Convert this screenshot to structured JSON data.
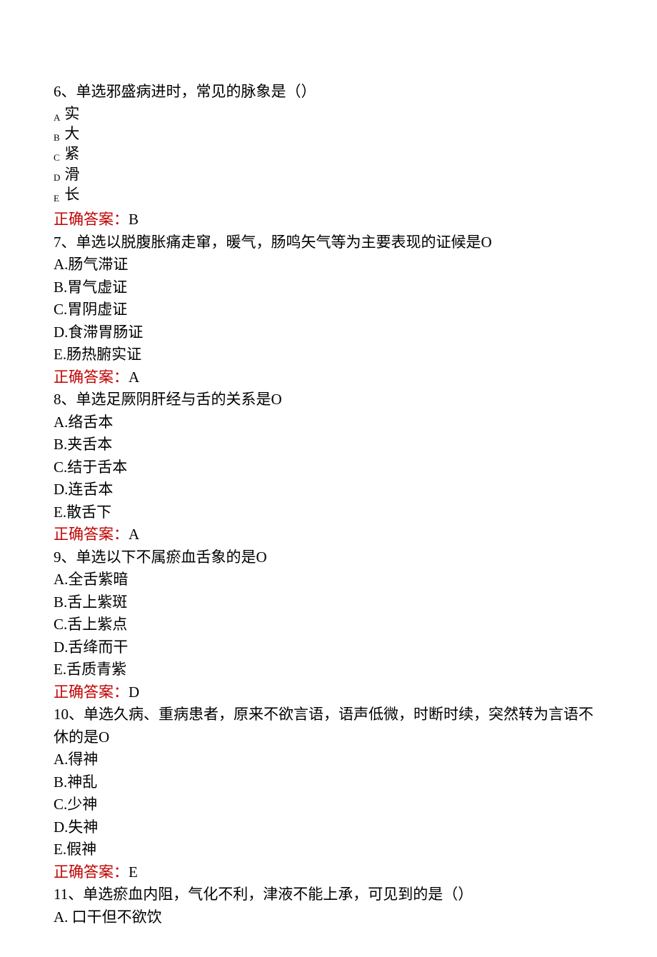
{
  "q6": {
    "stem": "6、单选邪盛病进时，常见的脉象是（）",
    "letters": [
      "A",
      "B",
      "C",
      "D",
      "E"
    ],
    "opts": [
      "实",
      "大",
      "紧",
      "滑",
      "长"
    ],
    "ans_label": "正确答案：",
    "ans_value": "B"
  },
  "q7": {
    "stem": "7、单选以脱腹胀痛走窜，暖气，肠鸣矢气等为主要表现的证候是O",
    "opts": {
      "a": "A.肠气滞证",
      "b": "B.胃气虚证",
      "c": "C.胃阴虚证",
      "d": "D.食滞胃肠证",
      "e": "E.肠热腑实证"
    },
    "ans_label": "正确答案：",
    "ans_value": "A"
  },
  "q8": {
    "stem": "8、单选足厥阴肝经与舌的关系是O",
    "opts": {
      "a": "A.络舌本",
      "b": "B.夹舌本",
      "c": "C.结于舌本",
      "d": "D.连舌本",
      "e": "E.散舌下"
    },
    "ans_label": "正确答案：",
    "ans_value": "A"
  },
  "q9": {
    "stem": "9、单选以下不属瘀血舌象的是O",
    "opts": {
      "a": "A.全舌紫暗",
      "b": "B.舌上紫斑",
      "c": "C.舌上紫点",
      "d": "D.舌绛而干",
      "e": "E.舌质青紫"
    },
    "ans_label": "正确答案：",
    "ans_value": "D"
  },
  "q10": {
    "stem": "10、单选久病、重病患者，原来不欲言语，语声低微，时断时续，突然转为言语不休的是O",
    "opts": {
      "a": "A.得神",
      "b": "B.神乱",
      "c": "C.少神",
      "d": "D.失神",
      "e": "E.假神"
    },
    "ans_label": "正确答案：",
    "ans_value": "E"
  },
  "q11": {
    "stem": "11、单选瘀血内阻，气化不利，津液不能上承，可见到的是（）",
    "opts": {
      "a": "A. 口干但不欲饮"
    }
  }
}
